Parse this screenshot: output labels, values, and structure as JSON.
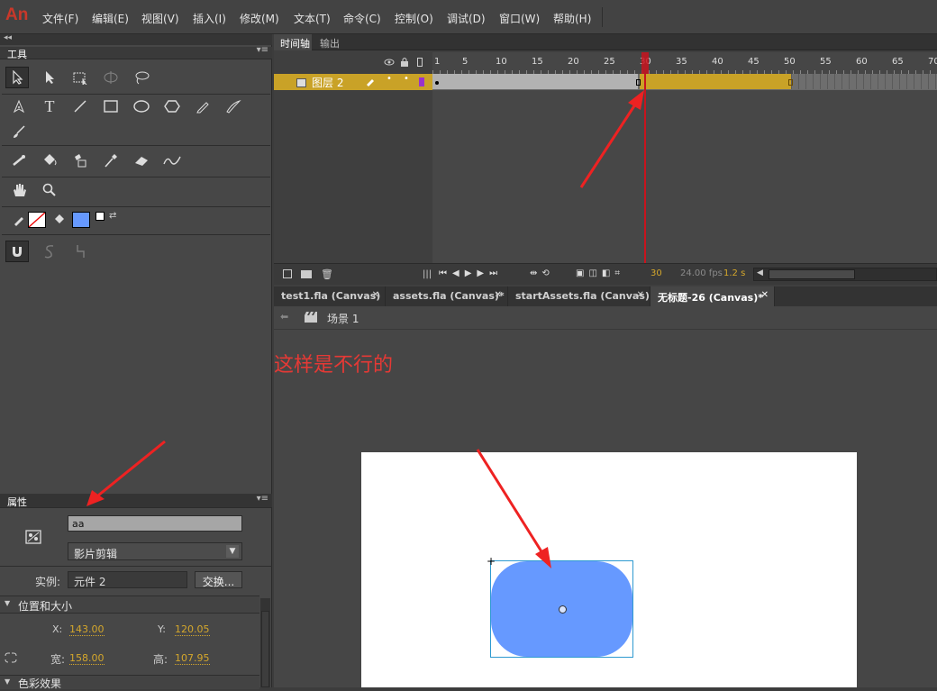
{
  "app": {
    "logo": "An"
  },
  "menu": [
    "文件(F)",
    "编辑(E)",
    "视图(V)",
    "插入(I)",
    "修改(M)",
    "文本(T)",
    "命令(C)",
    "控制(O)",
    "调试(D)",
    "窗口(W)",
    "帮助(H)"
  ],
  "tools_panel": {
    "collapse": "◂◂",
    "title": "工具"
  },
  "timeline": {
    "tabs": [
      "时间轴",
      "输出"
    ],
    "frame_numbers": [
      "1",
      "5",
      "10",
      "15",
      "20",
      "25",
      "30",
      "35",
      "40",
      "45",
      "50",
      "55",
      "60",
      "65",
      "70"
    ],
    "layer": {
      "name": "图层 2"
    },
    "status": {
      "frame": "30",
      "fps": "24.00 fps",
      "time": "1.2 s"
    }
  },
  "doc_tabs": [
    "test1.fla (Canvas)",
    "assets.fla (Canvas)*",
    "startAssets.fla (Canvas)",
    "无标题-26 (Canvas)*"
  ],
  "doc_tab_close": "✕",
  "scene": {
    "label": "场景 1"
  },
  "annotation": "这样是不行的",
  "properties": {
    "title": "属性",
    "instance_name": "aa",
    "symbol_type": "影片剪辑",
    "instance_label": "实例:",
    "instance_value": "元件 2",
    "swap_button": "交换...",
    "section_pos": "位置和大小",
    "x_label": "X:",
    "x_value": "143.00",
    "y_label": "Y:",
    "y_value": "120.05",
    "w_label": "宽:",
    "w_value": "158.00",
    "h_label": "高:",
    "h_value": "107.95",
    "section_color": "色彩效果"
  },
  "colors": {
    "accent": "#c9a227",
    "shape_fill": "#6699ff",
    "annotation": "#e53935",
    "playhead": "#c8141e"
  }
}
